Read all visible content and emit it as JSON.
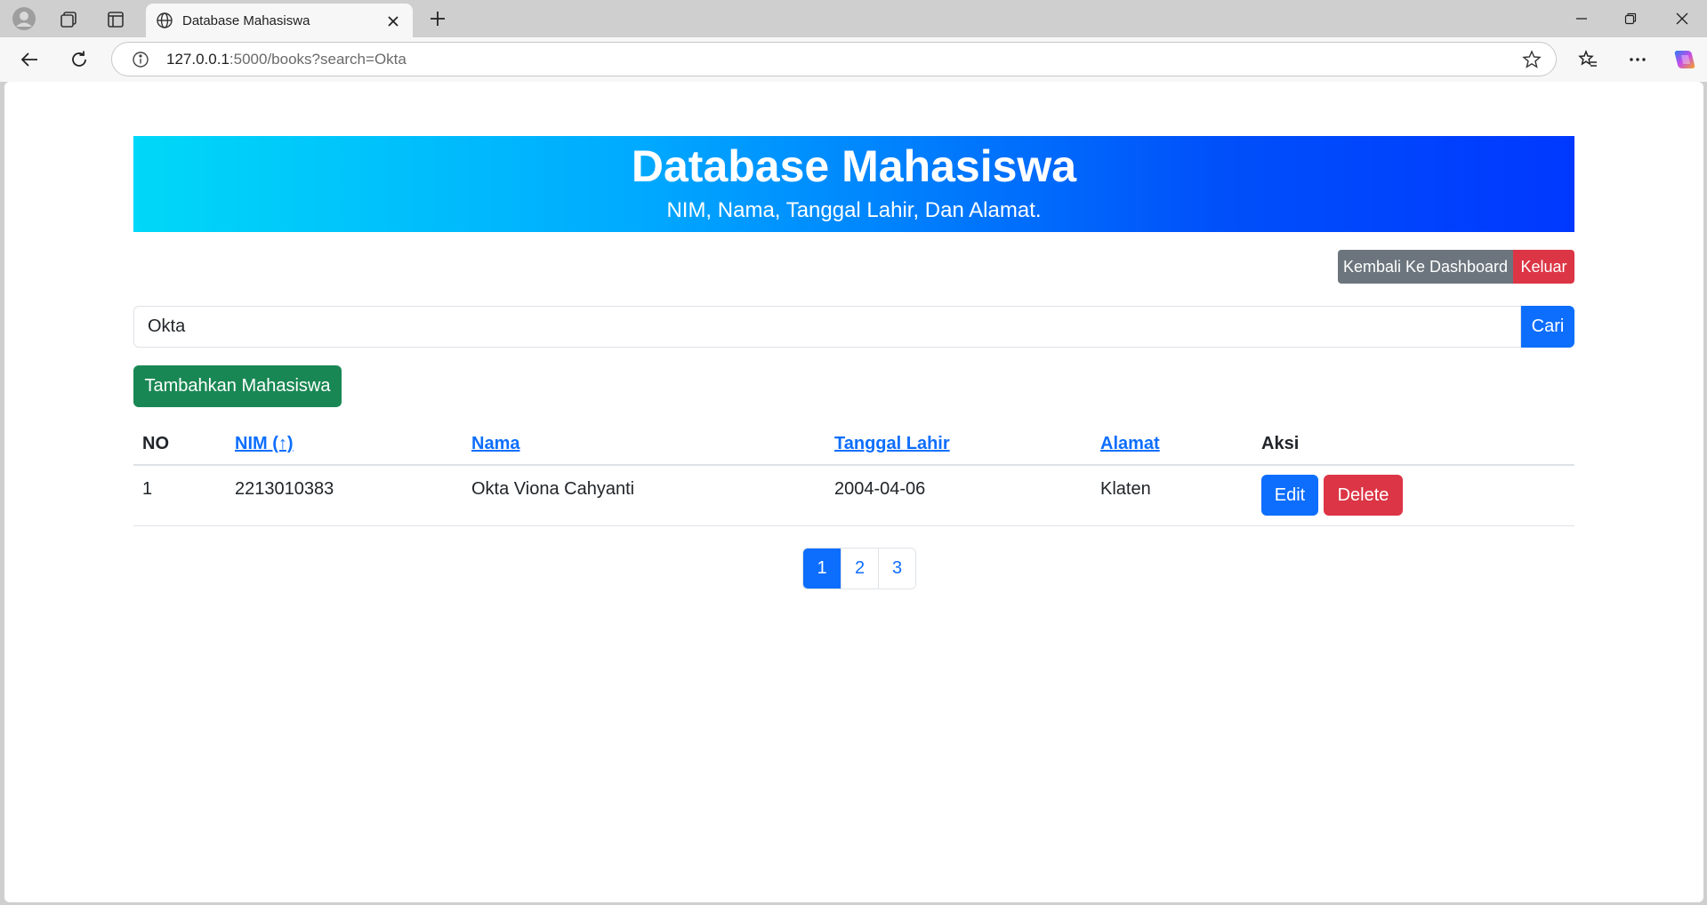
{
  "browser": {
    "tab_title": "Database Mahasiswa",
    "url_host": "127.0.0.1",
    "url_rest": ":5000/books?search=Okta",
    "icons": [
      "profile-icon",
      "collections-icon",
      "tab-actions-icon",
      "globe-icon",
      "close-icon",
      "new-tab-icon",
      "minimize-icon",
      "restore-icon",
      "window-close-icon",
      "back-icon",
      "reload-icon",
      "site-info-icon",
      "favorite-star-icon",
      "favorites-icon",
      "more-icon",
      "copilot-icon"
    ]
  },
  "header": {
    "title": "Database Mahasiswa",
    "subtitle": "NIM, Nama, Tanggal Lahir, Dan Alamat."
  },
  "actions": {
    "dashboard_label": "Kembali Ke Dashboard",
    "logout_label": "Keluar"
  },
  "search": {
    "value": "Okta",
    "button_label": "Cari"
  },
  "add_button_label": "Tambahkan Mahasiswa",
  "table": {
    "headers": {
      "no": "NO",
      "nim": "NIM (↑)",
      "nama": "Nama",
      "tanggal_lahir": "Tanggal Lahir",
      "alamat": "Alamat",
      "aksi": "Aksi"
    },
    "rows": [
      {
        "no": "1",
        "nim": "2213010383",
        "nama": "Okta Viona Cahyanti",
        "tanggal_lahir": "2004-04-06",
        "alamat": "Klaten",
        "edit_label": "Edit",
        "delete_label": "Delete"
      }
    ]
  },
  "pagination": {
    "pages": [
      "1",
      "2",
      "3"
    ],
    "active_page": "1"
  },
  "colors": {
    "primary": "#0d6efd",
    "danger": "#dc3545",
    "success": "#198754",
    "secondary": "#6c757d",
    "banner_start": "#00d8f8",
    "banner_end": "#0038ff"
  }
}
